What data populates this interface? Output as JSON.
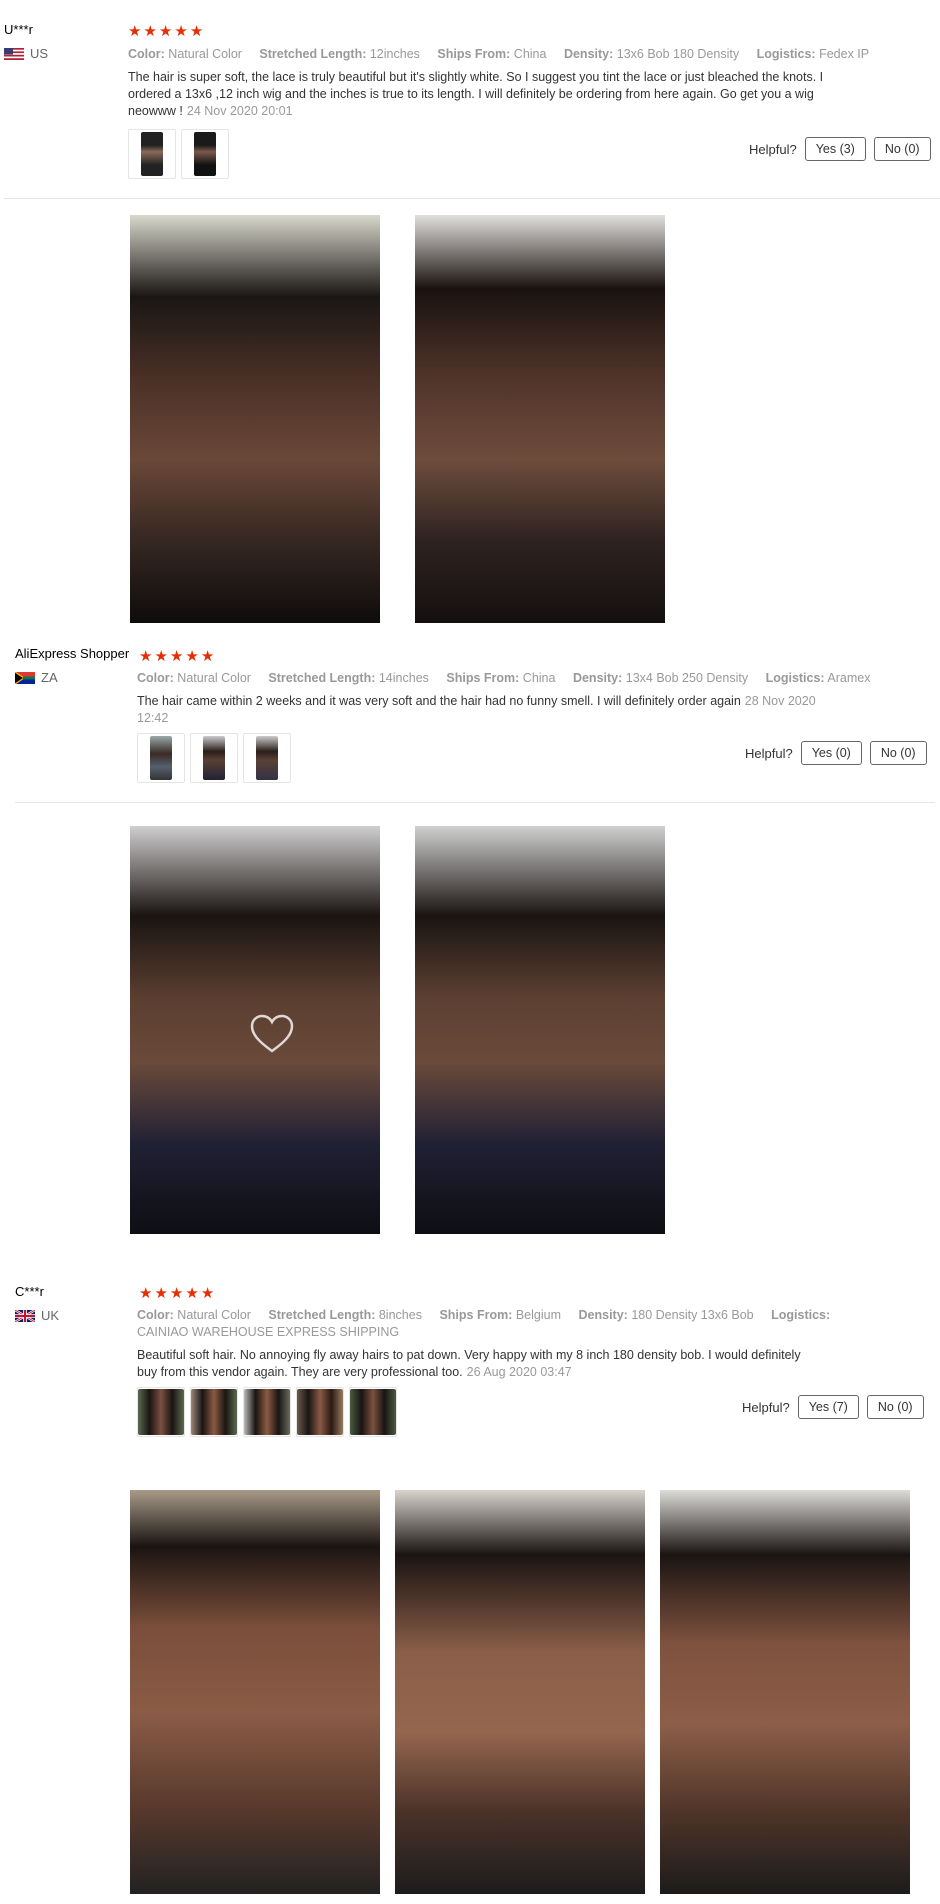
{
  "helpful_label": "Helpful?",
  "reviews": [
    {
      "name": "U***r",
      "country": "US",
      "stars": [
        "★",
        "★",
        "★",
        "★",
        "★"
      ],
      "attrs": [
        {
          "k": "Color:",
          "v": "Natural Color"
        },
        {
          "k": "Stretched Length:",
          "v": "12inches"
        },
        {
          "k": "Ships From:",
          "v": "China"
        },
        {
          "k": "Density:",
          "v": "13x6 Bob 180 Density"
        },
        {
          "k": "Logistics:",
          "v": "Fedex IP"
        }
      ],
      "text": "The hair is super soft, the lace is truly beautiful but it's slightly white. So I suggest you tint the lace or just bleached the knots. I ordered a 13x6 ,12 inch wig and the inches is true to its length. I will definitely be ordering from here again. Go get you a wig neowww !",
      "date": "24 Nov 2020 20:01",
      "yes": "Yes (3)",
      "no": "No (0)"
    },
    {
      "name": "AliExpress Shopper",
      "country": "ZA",
      "stars": [
        "★",
        "★",
        "★",
        "★",
        "★"
      ],
      "attrs": [
        {
          "k": "Color:",
          "v": "Natural Color"
        },
        {
          "k": "Stretched Length:",
          "v": "14inches"
        },
        {
          "k": "Ships From:",
          "v": "China"
        },
        {
          "k": "Density:",
          "v": "13x4 Bob 250 Density"
        },
        {
          "k": "Logistics:",
          "v": "Aramex"
        }
      ],
      "text": "The hair came within 2 weeks and it was very soft and the hair had no funny smell. I will definitely order again",
      "date": "28 Nov 2020 12:42",
      "yes": "Yes (0)",
      "no": "No (0)"
    },
    {
      "name": "C***r",
      "country": "UK",
      "stars": [
        "★",
        "★",
        "★",
        "★",
        "★"
      ],
      "attrs": [
        {
          "k": "Color:",
          "v": "Natural Color"
        },
        {
          "k": "Stretched Length:",
          "v": "8inches"
        },
        {
          "k": "Ships From:",
          "v": "Belgium"
        },
        {
          "k": "Density:",
          "v": "180 Density 13x6 Bob"
        },
        {
          "k": "Logistics:",
          "v": "CAINIAO WAREHOUSE EXPRESS SHIPPING"
        }
      ],
      "text": "Beautiful soft hair. No annoying fly away hairs to pat down. Very happy with my 8 inch 180 density bob. I would definitely buy from this vendor again. They are very professional too.",
      "date": "26 Aug 2020 03:47",
      "yes": "Yes (7)",
      "no": "No (0)"
    }
  ]
}
